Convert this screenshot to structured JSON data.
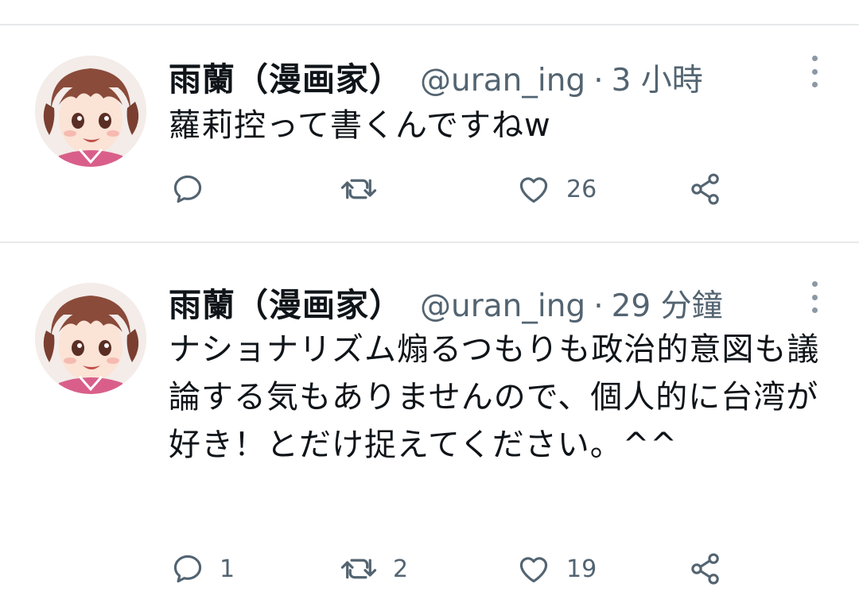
{
  "tweets": [
    {
      "display_name": "雨蘭（漫画家）",
      "handle": "@uran_ing",
      "separator": "·",
      "time": "3 小時",
      "text": "蘿莉控って書くんですねw",
      "actions": {
        "reply_count": "",
        "retweet_count": "",
        "like_count": "26"
      }
    },
    {
      "display_name": "雨蘭（漫画家）",
      "handle": "@uran_ing",
      "separator": "·",
      "time": "29 分鐘",
      "text": "ナショナリズム煽るつもりも政治的意図も議論する気もありませんので、個人的に台湾が好き！とだけ捉えてください。^^",
      "actions": {
        "reply_count": "1",
        "retweet_count": "2",
        "like_count": "19"
      }
    }
  ],
  "colors": {
    "text": "#0f1419",
    "secondary": "#536471",
    "divider": "#e7e9ea",
    "icon": "#536471"
  },
  "icons": [
    "reply-icon",
    "retweet-icon",
    "like-icon",
    "share-icon",
    "more-icon"
  ]
}
